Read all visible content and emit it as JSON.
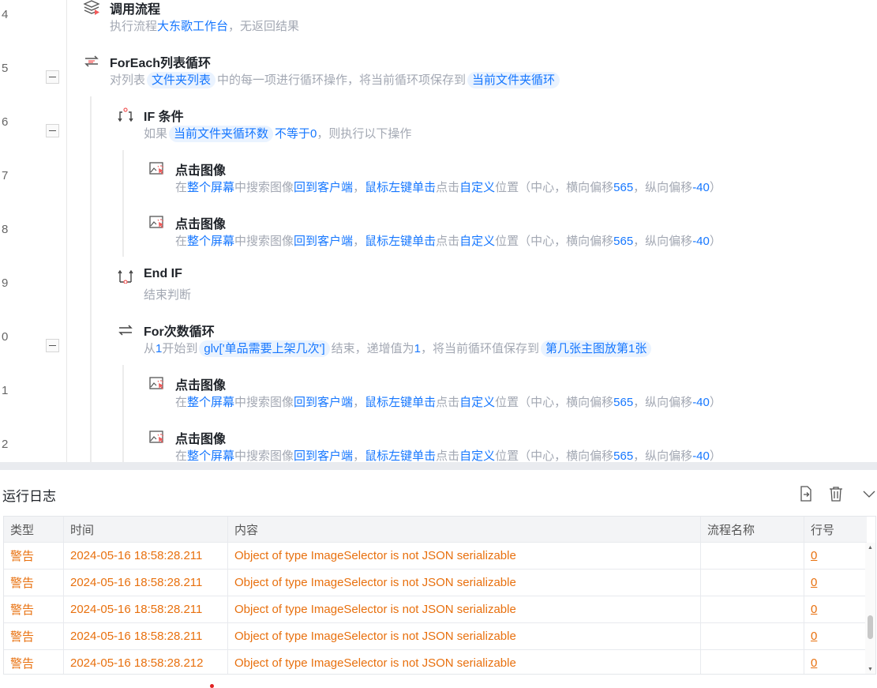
{
  "editor": {
    "line_numbers": [
      "4",
      "5",
      "6",
      "7",
      "8",
      "9",
      "0",
      "1",
      "2"
    ],
    "steps": [
      {
        "icon": "call-flow-icon",
        "title": "调用流程",
        "desc": [
          {
            "t": "执行流程",
            "k": "n"
          },
          {
            "t": "大东歌工作台",
            "k": "v"
          },
          {
            "t": "，无返回结果",
            "k": "n"
          }
        ]
      },
      {
        "icon": "foreach-loop-icon",
        "title": "ForEach列表循环",
        "desc": [
          {
            "t": "对列表",
            "k": "n"
          },
          {
            "t": "文件夹列表",
            "k": "chip"
          },
          {
            "t": "中的每一项进行循环操作，将当前循环项保存到",
            "k": "n"
          },
          {
            "t": "当前文件夹循环",
            "k": "chip"
          }
        ]
      },
      {
        "icon": "if-condition-icon",
        "title": "IF 条件",
        "desc": [
          {
            "t": "如果",
            "k": "n"
          },
          {
            "t": "当前文件夹循环数",
            "k": "chip"
          },
          {
            "t": "不等于0",
            "k": "v"
          },
          {
            "t": "，则执行以下操作",
            "k": "n"
          }
        ]
      },
      {
        "icon": "click-image-icon",
        "title": "点击图像",
        "desc": [
          {
            "t": "在",
            "k": "n"
          },
          {
            "t": "整个屏幕",
            "k": "v"
          },
          {
            "t": "中搜索图像",
            "k": "n"
          },
          {
            "t": "回到客户端",
            "k": "v"
          },
          {
            "t": "，",
            "k": "n"
          },
          {
            "t": "鼠标左键单击",
            "k": "v"
          },
          {
            "t": "点击",
            "k": "n"
          },
          {
            "t": "自定义",
            "k": "v"
          },
          {
            "t": "位置（中心，横向偏移",
            "k": "n"
          },
          {
            "t": "565",
            "k": "v"
          },
          {
            "t": "，纵向偏移",
            "k": "n"
          },
          {
            "t": "-40",
            "k": "v"
          },
          {
            "t": "）",
            "k": "n"
          }
        ]
      },
      {
        "icon": "click-image-icon",
        "title": "点击图像",
        "desc": [
          {
            "t": "在",
            "k": "n"
          },
          {
            "t": "整个屏幕",
            "k": "v"
          },
          {
            "t": "中搜索图像",
            "k": "n"
          },
          {
            "t": "回到客户端",
            "k": "v"
          },
          {
            "t": "，",
            "k": "n"
          },
          {
            "t": "鼠标左键单击",
            "k": "v"
          },
          {
            "t": "点击",
            "k": "n"
          },
          {
            "t": "自定义",
            "k": "v"
          },
          {
            "t": "位置（中心，横向偏移",
            "k": "n"
          },
          {
            "t": "565",
            "k": "v"
          },
          {
            "t": "，纵向偏移",
            "k": "n"
          },
          {
            "t": "-40",
            "k": "v"
          },
          {
            "t": "）",
            "k": "n"
          }
        ]
      },
      {
        "icon": "end-if-icon",
        "title": "End IF",
        "desc": [
          {
            "t": "结束判断",
            "k": "n"
          }
        ]
      },
      {
        "icon": "for-loop-icon",
        "title": "For次数循环",
        "desc": [
          {
            "t": "从",
            "k": "n"
          },
          {
            "t": "1",
            "k": "v"
          },
          {
            "t": "开始到",
            "k": "n"
          },
          {
            "t": "glv['单品需要上架几次']",
            "k": "chip"
          },
          {
            "t": "结束，递增值为",
            "k": "n"
          },
          {
            "t": "1",
            "k": "v"
          },
          {
            "t": "，将当前循环值保存到",
            "k": "n"
          },
          {
            "t": "第几张主图放第1张",
            "k": "chip"
          }
        ]
      },
      {
        "icon": "click-image-icon",
        "title": "点击图像",
        "desc": [
          {
            "t": "在",
            "k": "n"
          },
          {
            "t": "整个屏幕",
            "k": "v"
          },
          {
            "t": "中搜索图像",
            "k": "n"
          },
          {
            "t": "回到客户端",
            "k": "v"
          },
          {
            "t": "，",
            "k": "n"
          },
          {
            "t": "鼠标左键单击",
            "k": "v"
          },
          {
            "t": "点击",
            "k": "n"
          },
          {
            "t": "自定义",
            "k": "v"
          },
          {
            "t": "位置（中心，横向偏移",
            "k": "n"
          },
          {
            "t": "565",
            "k": "v"
          },
          {
            "t": "，纵向偏移",
            "k": "n"
          },
          {
            "t": "-40",
            "k": "v"
          },
          {
            "t": "）",
            "k": "n"
          }
        ]
      },
      {
        "icon": "click-image-icon",
        "title": "点击图像",
        "desc": [
          {
            "t": "在",
            "k": "n"
          },
          {
            "t": "整个屏幕",
            "k": "v"
          },
          {
            "t": "中搜索图像",
            "k": "n"
          },
          {
            "t": "回到客户端",
            "k": "v"
          },
          {
            "t": "，",
            "k": "n"
          },
          {
            "t": "鼠标左键单击",
            "k": "v"
          },
          {
            "t": "点击",
            "k": "n"
          },
          {
            "t": "自定义",
            "k": "v"
          },
          {
            "t": "位置（中心，横向偏移",
            "k": "n"
          },
          {
            "t": "565",
            "k": "v"
          },
          {
            "t": "，纵向偏移",
            "k": "n"
          },
          {
            "t": "-40",
            "k": "v"
          },
          {
            "t": "）",
            "k": "n"
          }
        ]
      }
    ]
  },
  "log": {
    "title": "运行日志",
    "headers": [
      "类型",
      "时间",
      "内容",
      "流程名称",
      "行号"
    ],
    "rows": [
      [
        "警告",
        "2024-05-16 18:58:28.211",
        "Object of type ImageSelector is not JSON serializable",
        "",
        "0"
      ],
      [
        "警告",
        "2024-05-16 18:58:28.211",
        "Object of type ImageSelector is not JSON serializable",
        "",
        "0"
      ],
      [
        "警告",
        "2024-05-16 18:58:28.211",
        "Object of type ImageSelector is not JSON serializable",
        "",
        "0"
      ],
      [
        "警告",
        "2024-05-16 18:58:28.211",
        "Object of type ImageSelector is not JSON serializable",
        "",
        "0"
      ],
      [
        "警告",
        "2024-05-16 18:58:28.212",
        "Object of type ImageSelector is not JSON serializable",
        "",
        "0"
      ]
    ]
  },
  "colors": {
    "accent": "#1677ff",
    "warning": "#e8700e",
    "muted": "#a3a8b3"
  }
}
